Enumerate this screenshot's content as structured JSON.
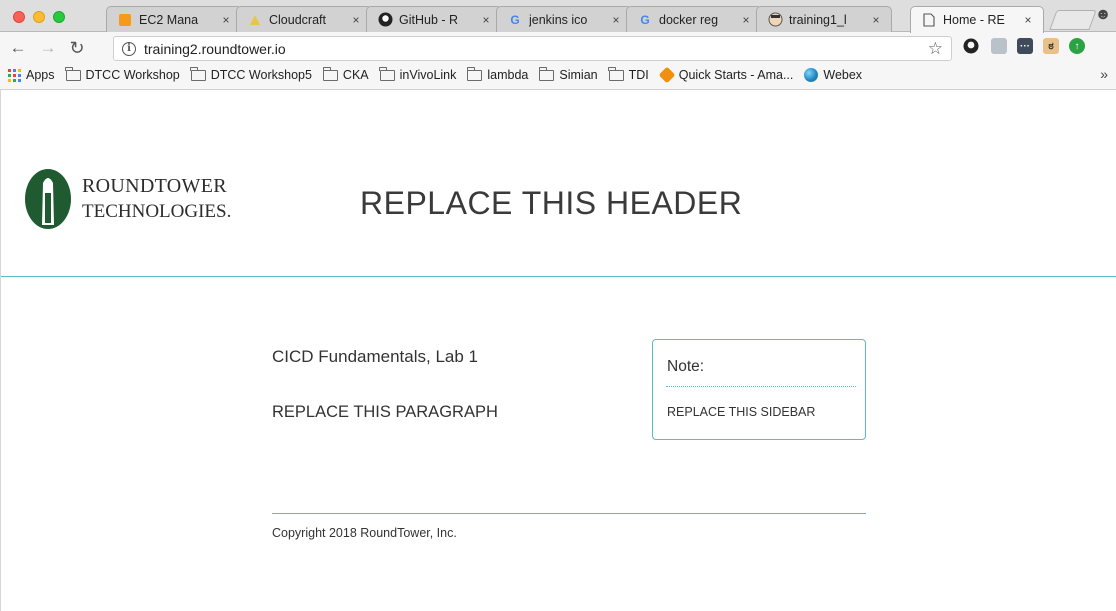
{
  "browser": {
    "tabs": [
      {
        "label": "EC2 Mana",
        "icon": "aws-icon",
        "active": false
      },
      {
        "label": "Cloudcraft",
        "icon": "cloudcraft-icon",
        "active": false
      },
      {
        "label": "GitHub - R",
        "icon": "github-icon",
        "active": false
      },
      {
        "label": "jenkins ico",
        "icon": "google-icon",
        "active": false
      },
      {
        "label": "docker reg",
        "icon": "google-icon",
        "active": false
      },
      {
        "label": "training1_l",
        "icon": "jenkins-icon",
        "active": false
      },
      {
        "label": "Home - RE",
        "icon": "page-icon",
        "active": true
      }
    ],
    "tab_close_glyph": "×",
    "url": "training2.roundtower.io",
    "bookmarks": [
      {
        "label": "Apps",
        "icon": "apps-grid-icon"
      },
      {
        "label": "DTCC Workshop",
        "icon": "folder-icon"
      },
      {
        "label": "DTCC Workshop5",
        "icon": "folder-icon"
      },
      {
        "label": "CKA",
        "icon": "folder-icon"
      },
      {
        "label": "inVivoLink",
        "icon": "folder-icon"
      },
      {
        "label": "lambda",
        "icon": "folder-icon"
      },
      {
        "label": "Simian",
        "icon": "folder-icon"
      },
      {
        "label": "TDI",
        "icon": "folder-icon"
      },
      {
        "label": "Quick Starts - Ama...",
        "icon": "aws-cube-icon"
      },
      {
        "label": "Webex",
        "icon": "webex-icon"
      }
    ],
    "bookmarks_overflow": "»"
  },
  "page": {
    "logo": {
      "line1": "ROUNDTOWER",
      "line2": "TECHNOLOGIES."
    },
    "header_title": "REPLACE THIS HEADER",
    "subtitle": "CICD Fundamentals, Lab 1",
    "paragraph": "REPLACE THIS PARAGRAPH",
    "sidebar": {
      "note_label": "Note:",
      "text": "REPLACE THIS SIDEBAR"
    },
    "footer": "Copyright 2018 RoundTower, Inc."
  },
  "colors": {
    "accent": "#5bbdbd",
    "logo_green": "#1f5a30"
  }
}
